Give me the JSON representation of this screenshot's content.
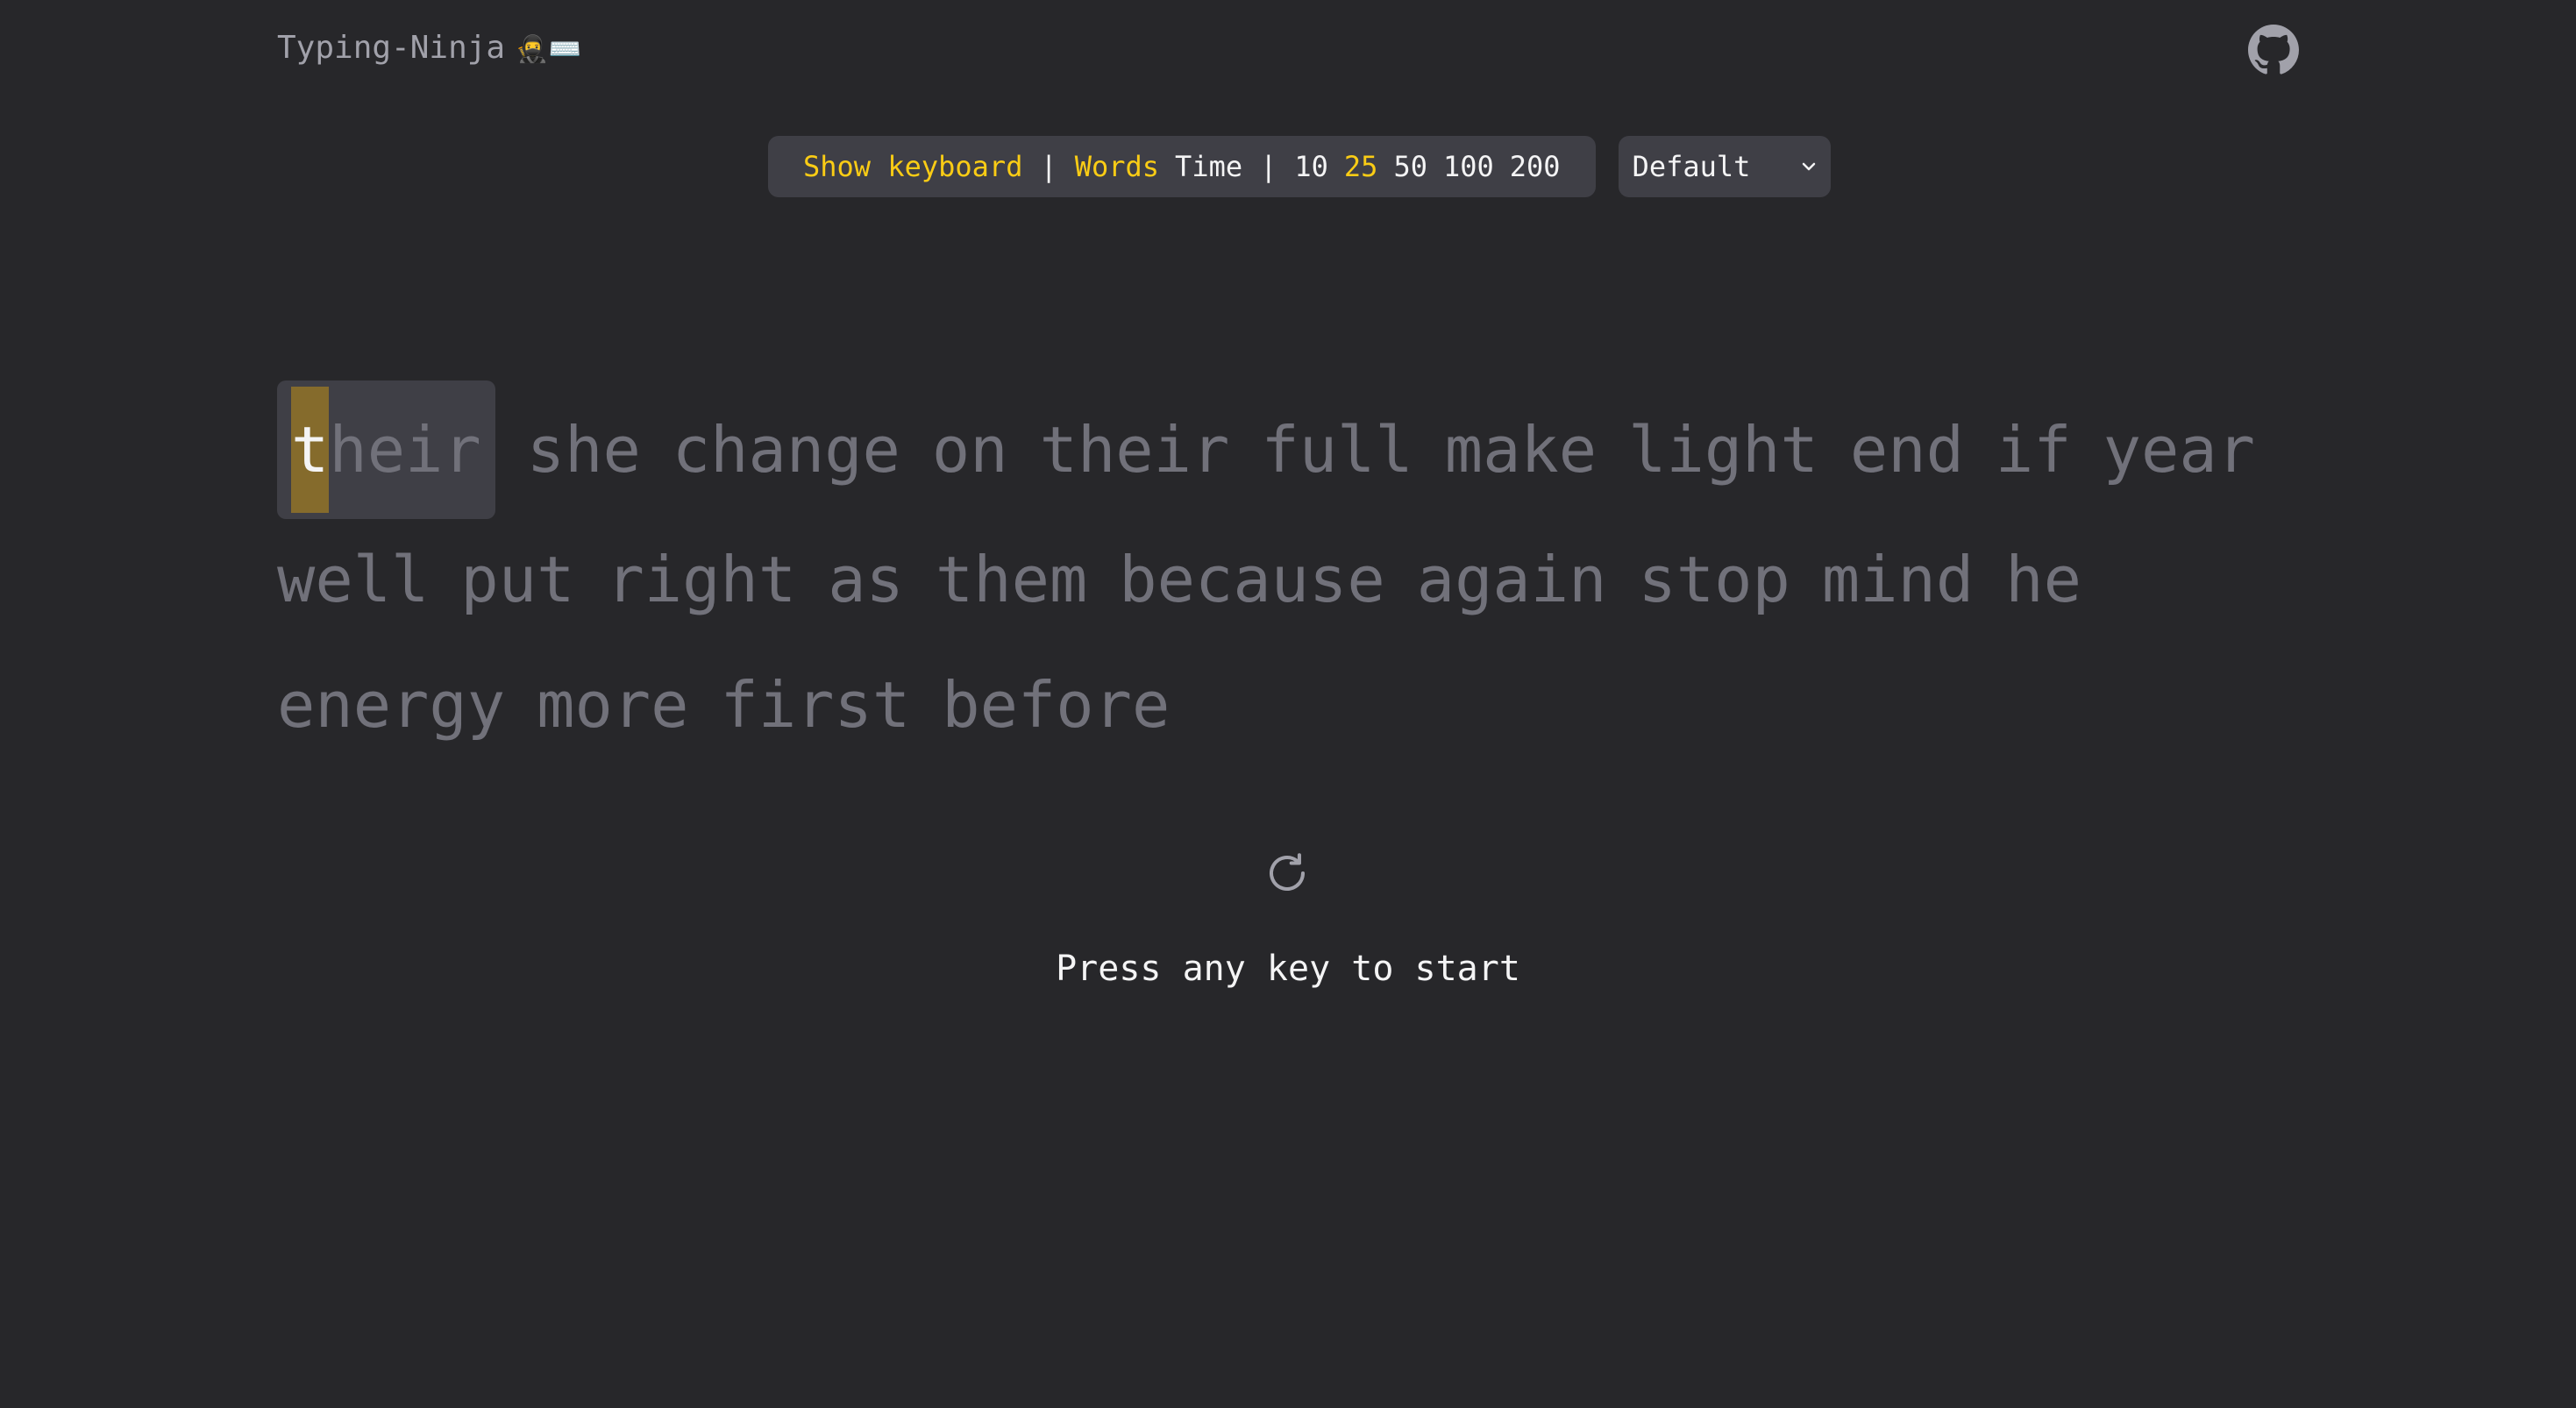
{
  "header": {
    "logo": "Typing-Ninja",
    "logo_emoji": "🥷⌨️",
    "github_icon": "github-icon"
  },
  "settings": {
    "show_keyboard": "Show keyboard",
    "separator": "|",
    "mode_words": "Words",
    "mode_time": "Time",
    "counts": [
      "10",
      "25",
      "50",
      "100",
      "200"
    ],
    "active_count": "25",
    "active_mode": "Words",
    "theme_select": "Default",
    "select_icon": "chevron-down-icon"
  },
  "test": {
    "current_word_first": "t",
    "current_word_rest": "heir",
    "line1": [
      "she",
      "change",
      "on",
      "their",
      "full",
      "make",
      "light",
      "end",
      "if",
      "year"
    ],
    "line2": [
      "well",
      "put",
      "right",
      "as",
      "them",
      "because",
      "again",
      "stop",
      "mind",
      "he"
    ],
    "line3": [
      "energy",
      "more",
      "first",
      "before"
    ]
  },
  "footer": {
    "restart_icon": "restart-icon",
    "hint": "Press any key to start"
  },
  "colors": {
    "background": "#27272a",
    "accent": "#facc15",
    "panel": "#3f3f46",
    "untyped_text": "#71717a",
    "caret": "#856b2c"
  }
}
